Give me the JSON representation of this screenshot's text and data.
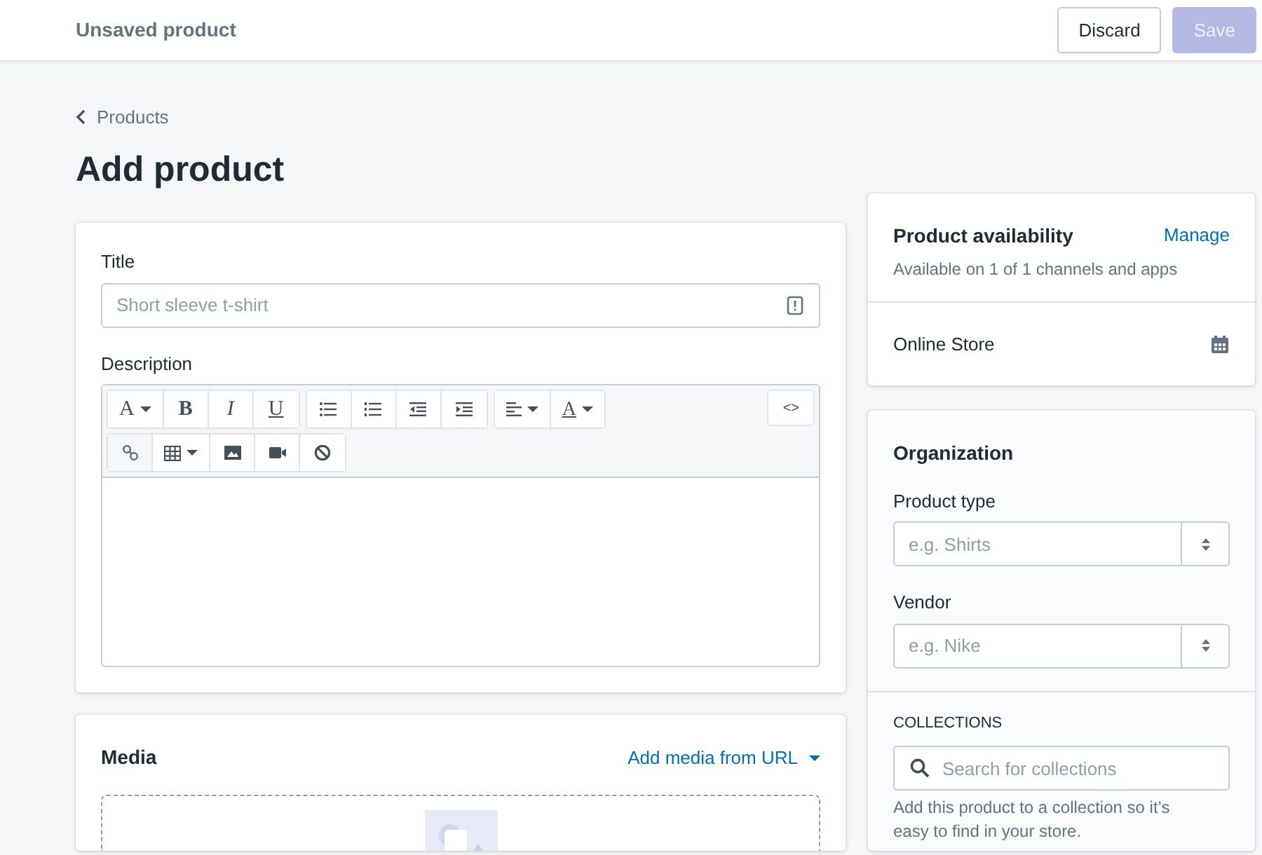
{
  "topbar": {
    "title": "Unsaved product",
    "buttons": [
      {
        "label": "Discard",
        "kind": "secondary"
      },
      {
        "label": "Save",
        "kind": "primary",
        "disabled": true
      }
    ]
  },
  "breadcrumb": "Products",
  "heading": "Add product",
  "product_card": {
    "title_label": "Title",
    "title_placeholder": "Short sleeve t-shirt",
    "description_label": "Description",
    "toolbar_rows": [
      [
        [
          {
            "kind": "font",
            "label": "A",
            "dropdown": true
          },
          {
            "kind": "bold",
            "label": "B"
          },
          {
            "kind": "italic",
            "label": "I"
          },
          {
            "kind": "underline",
            "label": "U"
          }
        ],
        [
          {
            "kind": "bullet-list"
          },
          {
            "kind": "numbered-list"
          },
          {
            "kind": "outdent"
          },
          {
            "kind": "indent"
          }
        ],
        [
          {
            "kind": "align",
            "dropdown": true
          },
          {
            "kind": "text-color",
            "label": "A",
            "dropdown": true
          }
        ]
      ],
      [
        [
          {
            "kind": "link"
          },
          {
            "kind": "table",
            "dropdown": true
          },
          {
            "kind": "image"
          },
          {
            "kind": "video"
          },
          {
            "kind": "clear"
          }
        ]
      ]
    ],
    "code_button": "<>"
  },
  "media_card": {
    "title": "Media",
    "link": "Add media from URL"
  },
  "availability": {
    "title": "Product availability",
    "link": "Manage",
    "subtitle": "Available on 1 of 1 channels and apps",
    "channel": "Online Store"
  },
  "organization": {
    "title": "Organization",
    "fields": [
      {
        "label": "Product type",
        "placeholder": "e.g. Shirts"
      },
      {
        "label": "Vendor",
        "placeholder": "e.g. Nike"
      }
    ],
    "collections": {
      "heading": "COLLECTIONS",
      "placeholder": "Search for collections",
      "help": "Add this product to a collection so it’s easy to find in your store."
    }
  }
}
